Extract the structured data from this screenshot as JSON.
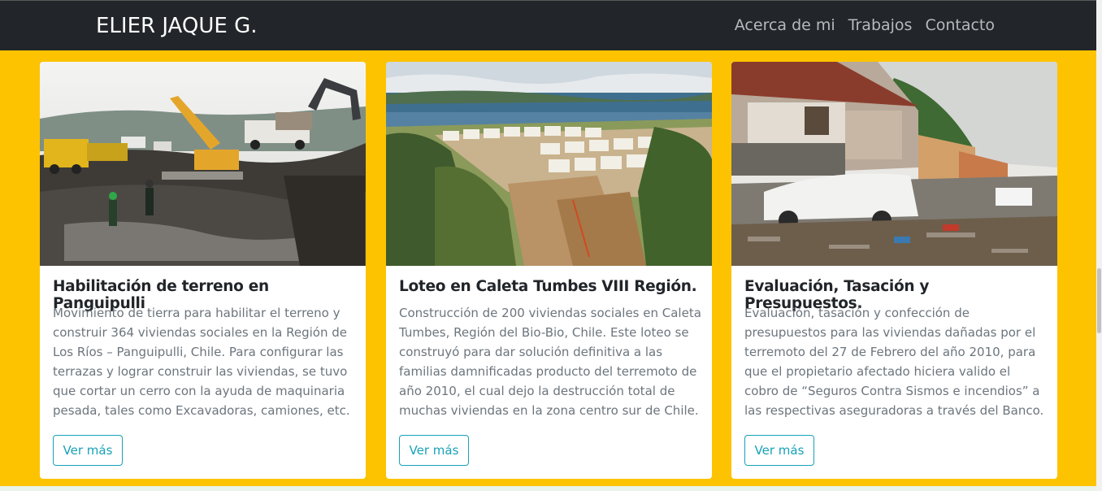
{
  "navbar": {
    "brand": "ELIER JAQUE G.",
    "links": [
      "Acerca de mi",
      "Trabajos",
      "Contacto"
    ]
  },
  "cards": [
    {
      "title": "Habilitación de terreno en Panguipulli",
      "text": "Movimiento de tierra para habilitar el terreno y construir 364 viviendas sociales en la Región de Los Ríos – Panguipulli, Chile. Para configurar las terrazas y lograr construir las viviendas, se tuvo que cortar un cerro con la ayuda de maquinaria pesada, tales como Excavadoras, camiones, etc.",
      "button": "Ver más"
    },
    {
      "title": "Loteo en Caleta Tumbes VIII Región.",
      "text": "Construcción de 200 viviendas sociales en Caleta Tumbes, Región del Bio-Bio, Chile. Este loteo se construyó para dar solución definitiva a las familias damnificadas producto del terremoto de año 2010, el cual dejo la destrucción total de muchas viviendas en la zona centro sur de Chile.",
      "button": "Ver más"
    },
    {
      "title": "Evaluación, Tasación y Presupuestos.",
      "text": "Evaluación, tasación y confección de presupuestos para las viviendas dañadas por el terremoto del 27 de Febrero del año 2010, para que el propietario afectado hiciera valido el cobro de “Seguros Contra Sismos e incendios” a las respectivas aseguradoras a través del Banco.",
      "button": "Ver más"
    }
  ],
  "colors": {
    "page_background": "#fdc300",
    "navbar_background": "#222529",
    "button_accent": "#17a2b8"
  }
}
